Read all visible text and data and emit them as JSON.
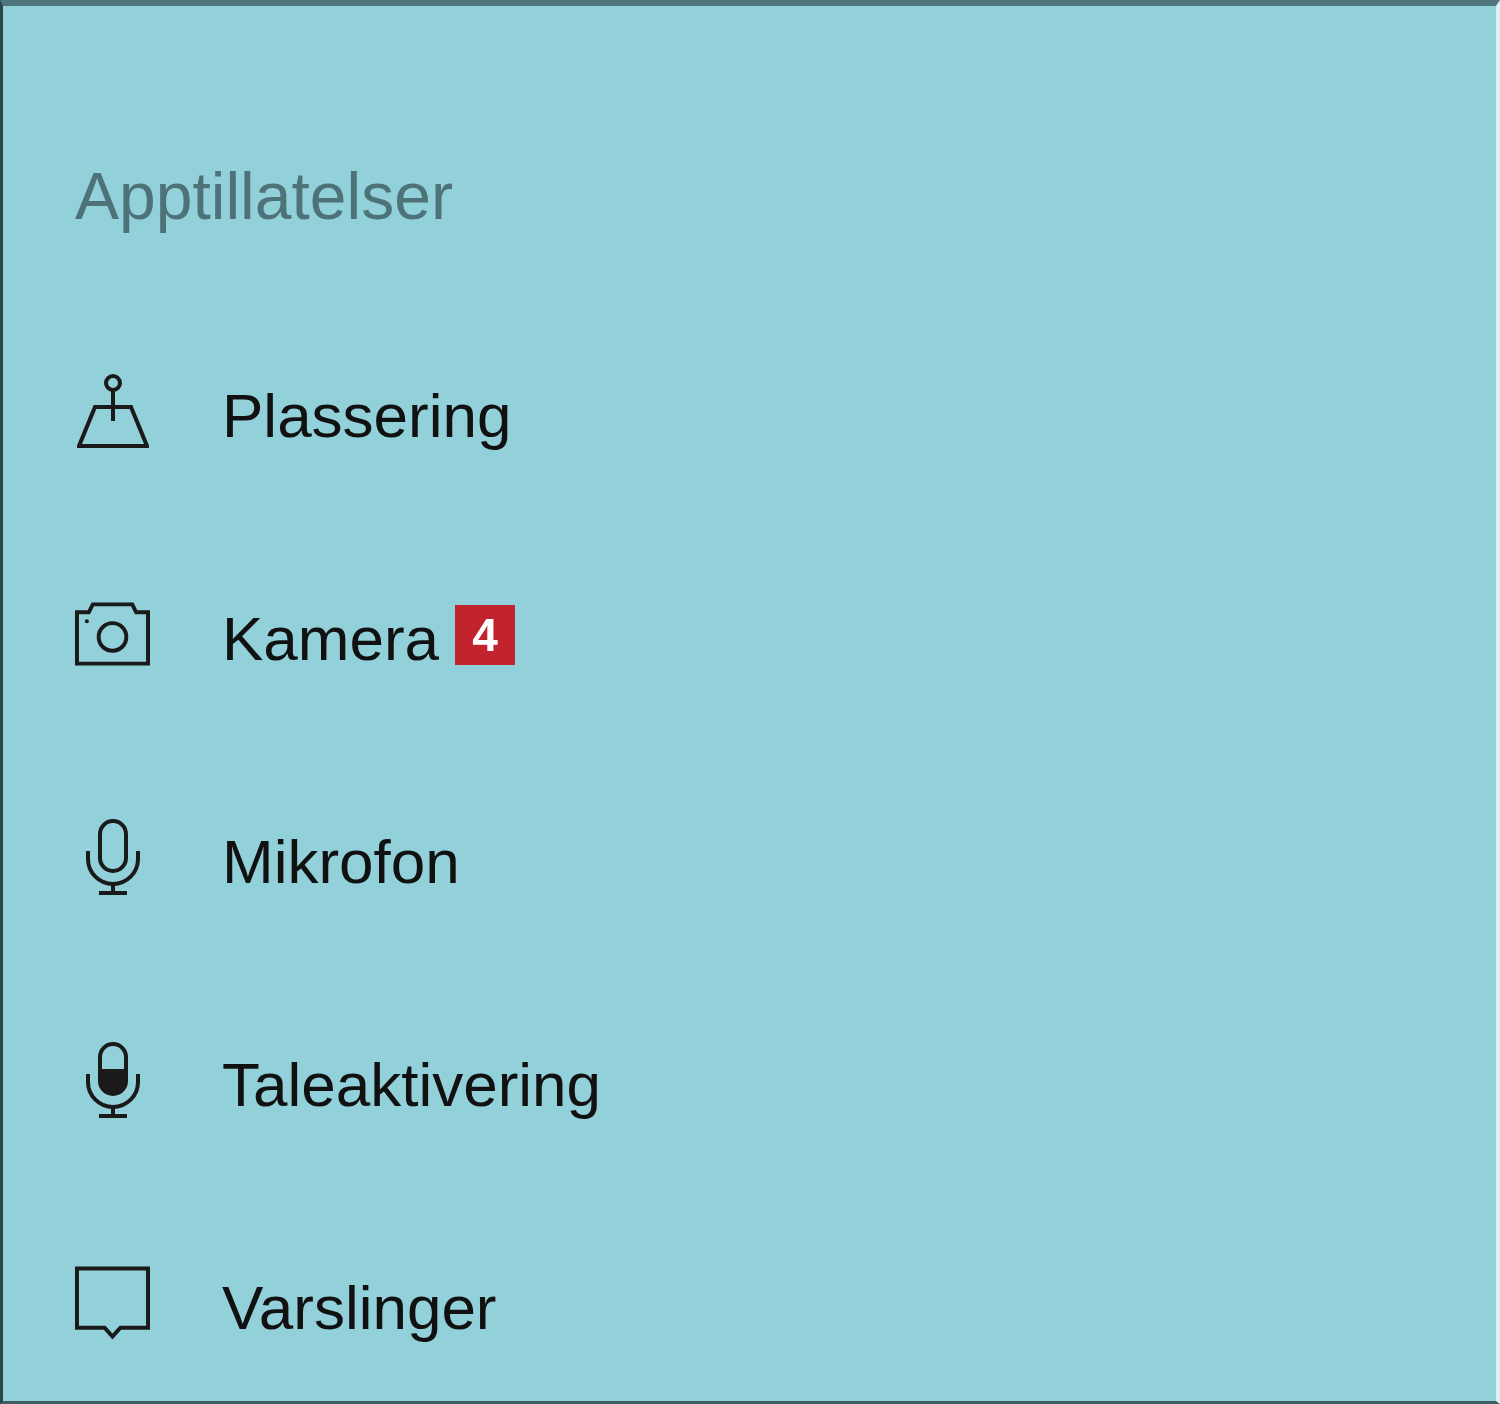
{
  "sidebar": {
    "heading": "Apptillatelser",
    "items": [
      {
        "label": "Plassering",
        "selected": false
      },
      {
        "label": "Kamera",
        "selected": false,
        "badge": "4"
      },
      {
        "label": "Mikrofon",
        "selected": false
      },
      {
        "label": "Taleaktivering",
        "selected": false
      },
      {
        "label": "Varslinger",
        "selected": false
      }
    ]
  }
}
